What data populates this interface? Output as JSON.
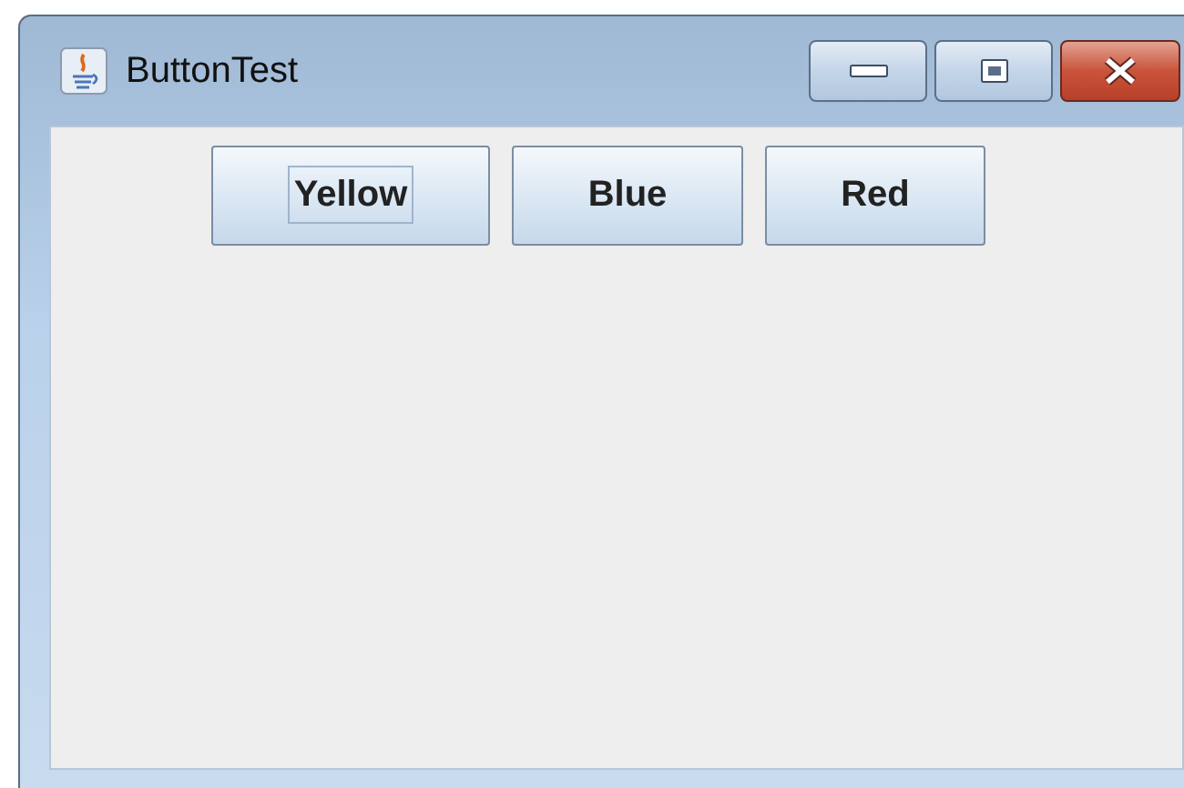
{
  "window": {
    "title": "ButtonTest"
  },
  "buttons": [
    {
      "label": "Yellow",
      "focused": true
    },
    {
      "label": "Blue",
      "focused": false
    },
    {
      "label": "Red",
      "focused": false
    }
  ]
}
